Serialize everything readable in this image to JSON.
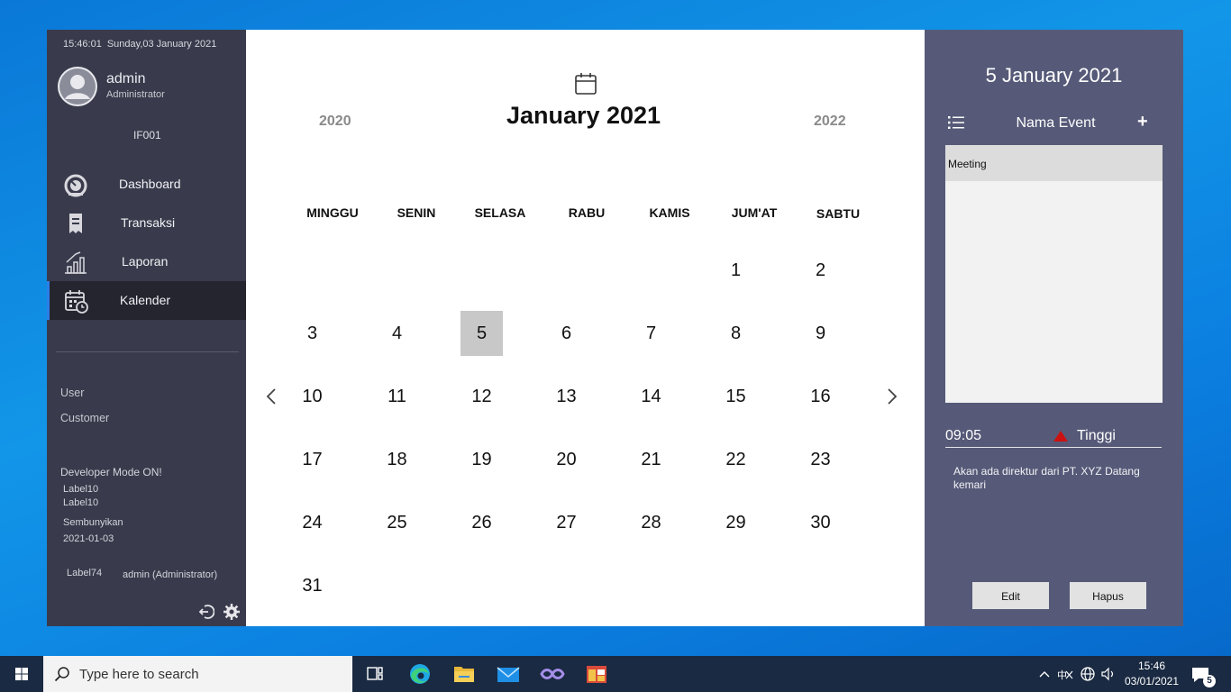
{
  "sidebar": {
    "time": "15:46:01",
    "date": "Sunday,03 January 2021",
    "username": "admin",
    "role": "Administrator",
    "user_id": "IF001",
    "nav": [
      {
        "label": "Dashboard",
        "icon": "dashboard-icon"
      },
      {
        "label": "Transaksi",
        "icon": "receipt-icon"
      },
      {
        "label": "Laporan",
        "icon": "chart-icon"
      },
      {
        "label": "Kalender",
        "icon": "calendar-icon",
        "active": true
      }
    ],
    "links": [
      "User",
      "Customer"
    ],
    "developer_mode": "Developer Mode ON!",
    "label10_a": "Label10",
    "label10_b": "Label10",
    "sembunyikan": "Sembunyikan",
    "debug_date": "2021-01-03",
    "label74": "Label74",
    "logged_user": "admin (Administrator)"
  },
  "calendar": {
    "title": "January 2021",
    "prev_year": "2020",
    "next_year": "2022",
    "weekdays": [
      "MINGGU",
      "SENIN",
      "SELASA",
      "RABU",
      "KAMIS",
      "JUM'AT",
      "SABTU"
    ],
    "selected_day": "5"
  },
  "panel": {
    "selected_date": "5 January 2021",
    "event_header": "Nama Event",
    "add_label": "+",
    "events": [
      "Meeting"
    ],
    "event_time": "09:05",
    "priority": "Tinggi",
    "priority_color": "#cc1111",
    "description": "Akan ada direktur dari PT. XYZ Datang kemari",
    "edit_label": "Edit",
    "delete_label": "Hapus"
  },
  "taskbar": {
    "search_placeholder": "Type here to search",
    "clock_time": "15:46",
    "clock_date": "03/01/2021",
    "notification_count": "5"
  }
}
